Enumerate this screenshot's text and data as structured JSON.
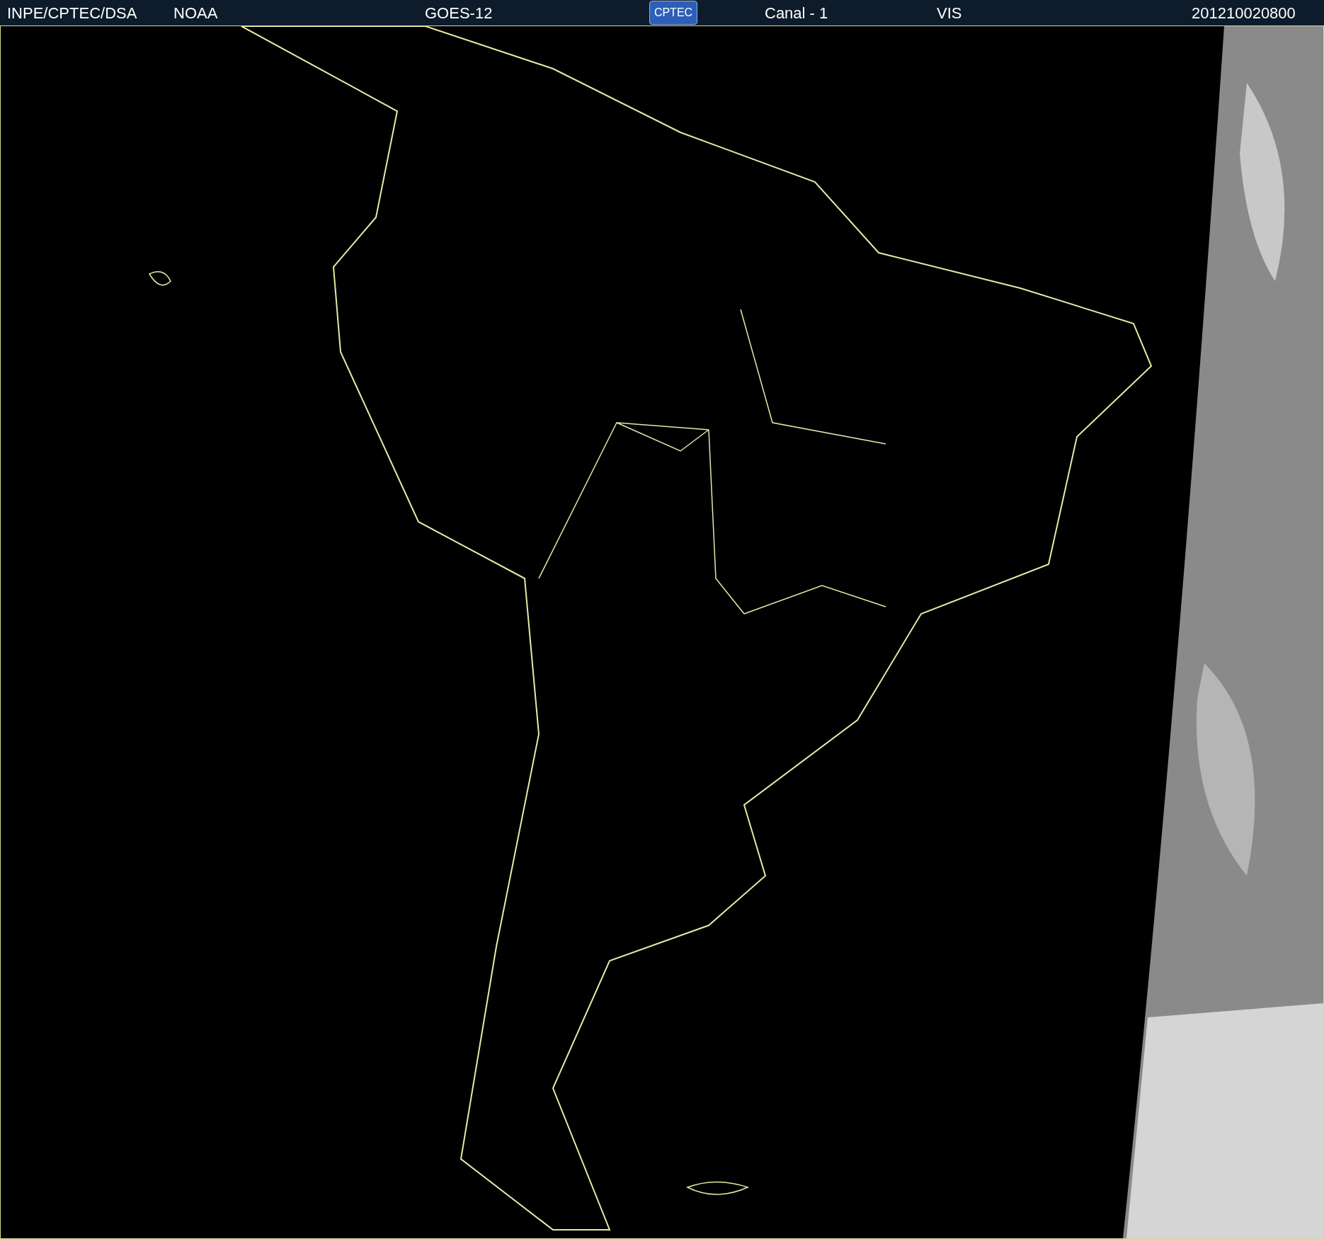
{
  "header": {
    "items": [
      {
        "kind": "text",
        "label": "INPE/CPTEC/DSA"
      },
      {
        "kind": "text",
        "label": "NOAA"
      },
      {
        "kind": "text",
        "label": "GOES-12"
      },
      {
        "kind": "logo",
        "label": "CPTEC"
      },
      {
        "kind": "text",
        "label": "Canal - 1"
      },
      {
        "kind": "text",
        "label": "VIS"
      },
      {
        "kind": "text",
        "label": "201210020800"
      }
    ]
  }
}
